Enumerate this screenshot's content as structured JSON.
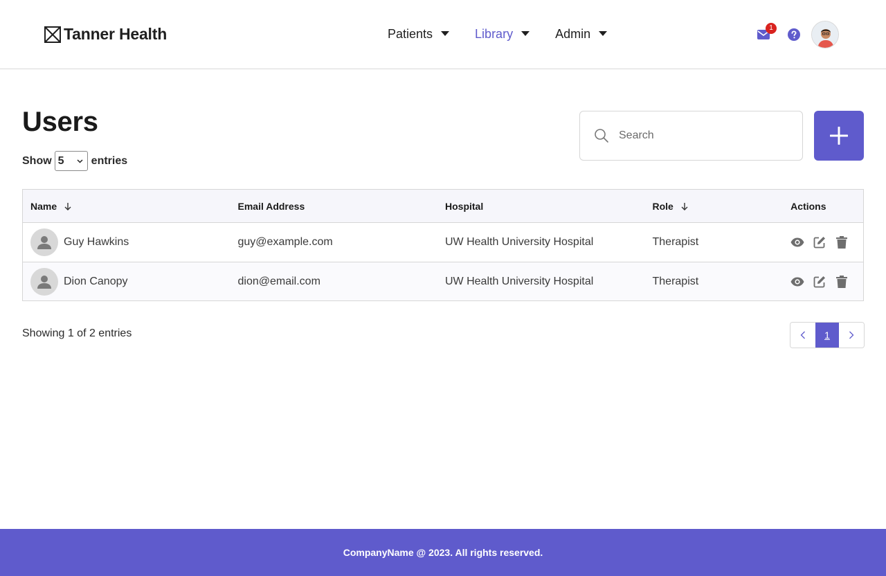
{
  "brand": {
    "name": "Tanner Health"
  },
  "nav": {
    "items": [
      {
        "label": "Patients",
        "active": false
      },
      {
        "label": "Library",
        "active": true
      },
      {
        "label": "Admin",
        "active": false
      }
    ]
  },
  "header": {
    "mail_badge_count": "1",
    "icons": [
      "mail-icon",
      "help-icon",
      "user-avatar"
    ]
  },
  "page": {
    "title": "Users"
  },
  "entries_control": {
    "prefix": "Show",
    "selected": "5",
    "suffix": "entries"
  },
  "search": {
    "placeholder": "Search",
    "value": ""
  },
  "add_button": {
    "icon": "plus-icon"
  },
  "table": {
    "columns": [
      {
        "label": "Name",
        "sortable": true
      },
      {
        "label": "Email Address",
        "sortable": false
      },
      {
        "label": "Hospital",
        "sortable": false
      },
      {
        "label": "Role",
        "sortable": true
      },
      {
        "label": "Actions",
        "sortable": false
      }
    ],
    "rows": [
      {
        "name": "Guy Hawkins",
        "email": "guy@example.com",
        "hospital": "UW Health University Hospital",
        "role": "Therapist"
      },
      {
        "name": "Dion Canopy",
        "email": "dion@email.com",
        "hospital": "UW Health University Hospital",
        "role": "Therapist"
      }
    ],
    "row_actions": [
      "eye-icon",
      "edit-icon",
      "trash-icon"
    ]
  },
  "pagination": {
    "summary": "Showing 1 of 2 entries",
    "current_page": "1"
  },
  "footer": {
    "text": "CompanyName @ 2023. All rights reserved."
  },
  "colors": {
    "accent": "#5f5bcc",
    "badge": "#d9231f",
    "icon_gray": "#6e6e6e"
  }
}
